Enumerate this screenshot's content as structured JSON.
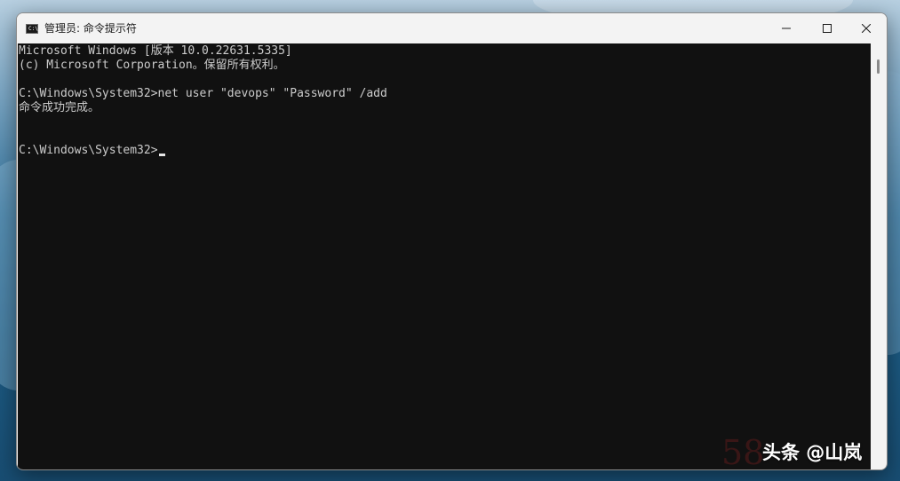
{
  "window": {
    "title": "管理员: 命令提示符",
    "app_icon": "cmd-icon",
    "app_icon_glyph": "C:\\"
  },
  "caption_buttons": {
    "minimize_icon": "minimize-icon",
    "maximize_icon": "maximize-icon",
    "close_icon": "close-icon"
  },
  "console": {
    "lines": [
      "Microsoft Windows [版本 10.0.22631.5335]",
      "(c) Microsoft Corporation。保留所有权利。",
      "",
      "C:\\Windows\\System32>net user \"devops\" \"Password\" /add",
      "命令成功完成。",
      "",
      "",
      "C:\\Windows\\System32>"
    ],
    "foreground": "#cccccc",
    "background": "#111111"
  },
  "watermark": {
    "text": "头条 @山岚",
    "faint_text": "58"
  }
}
